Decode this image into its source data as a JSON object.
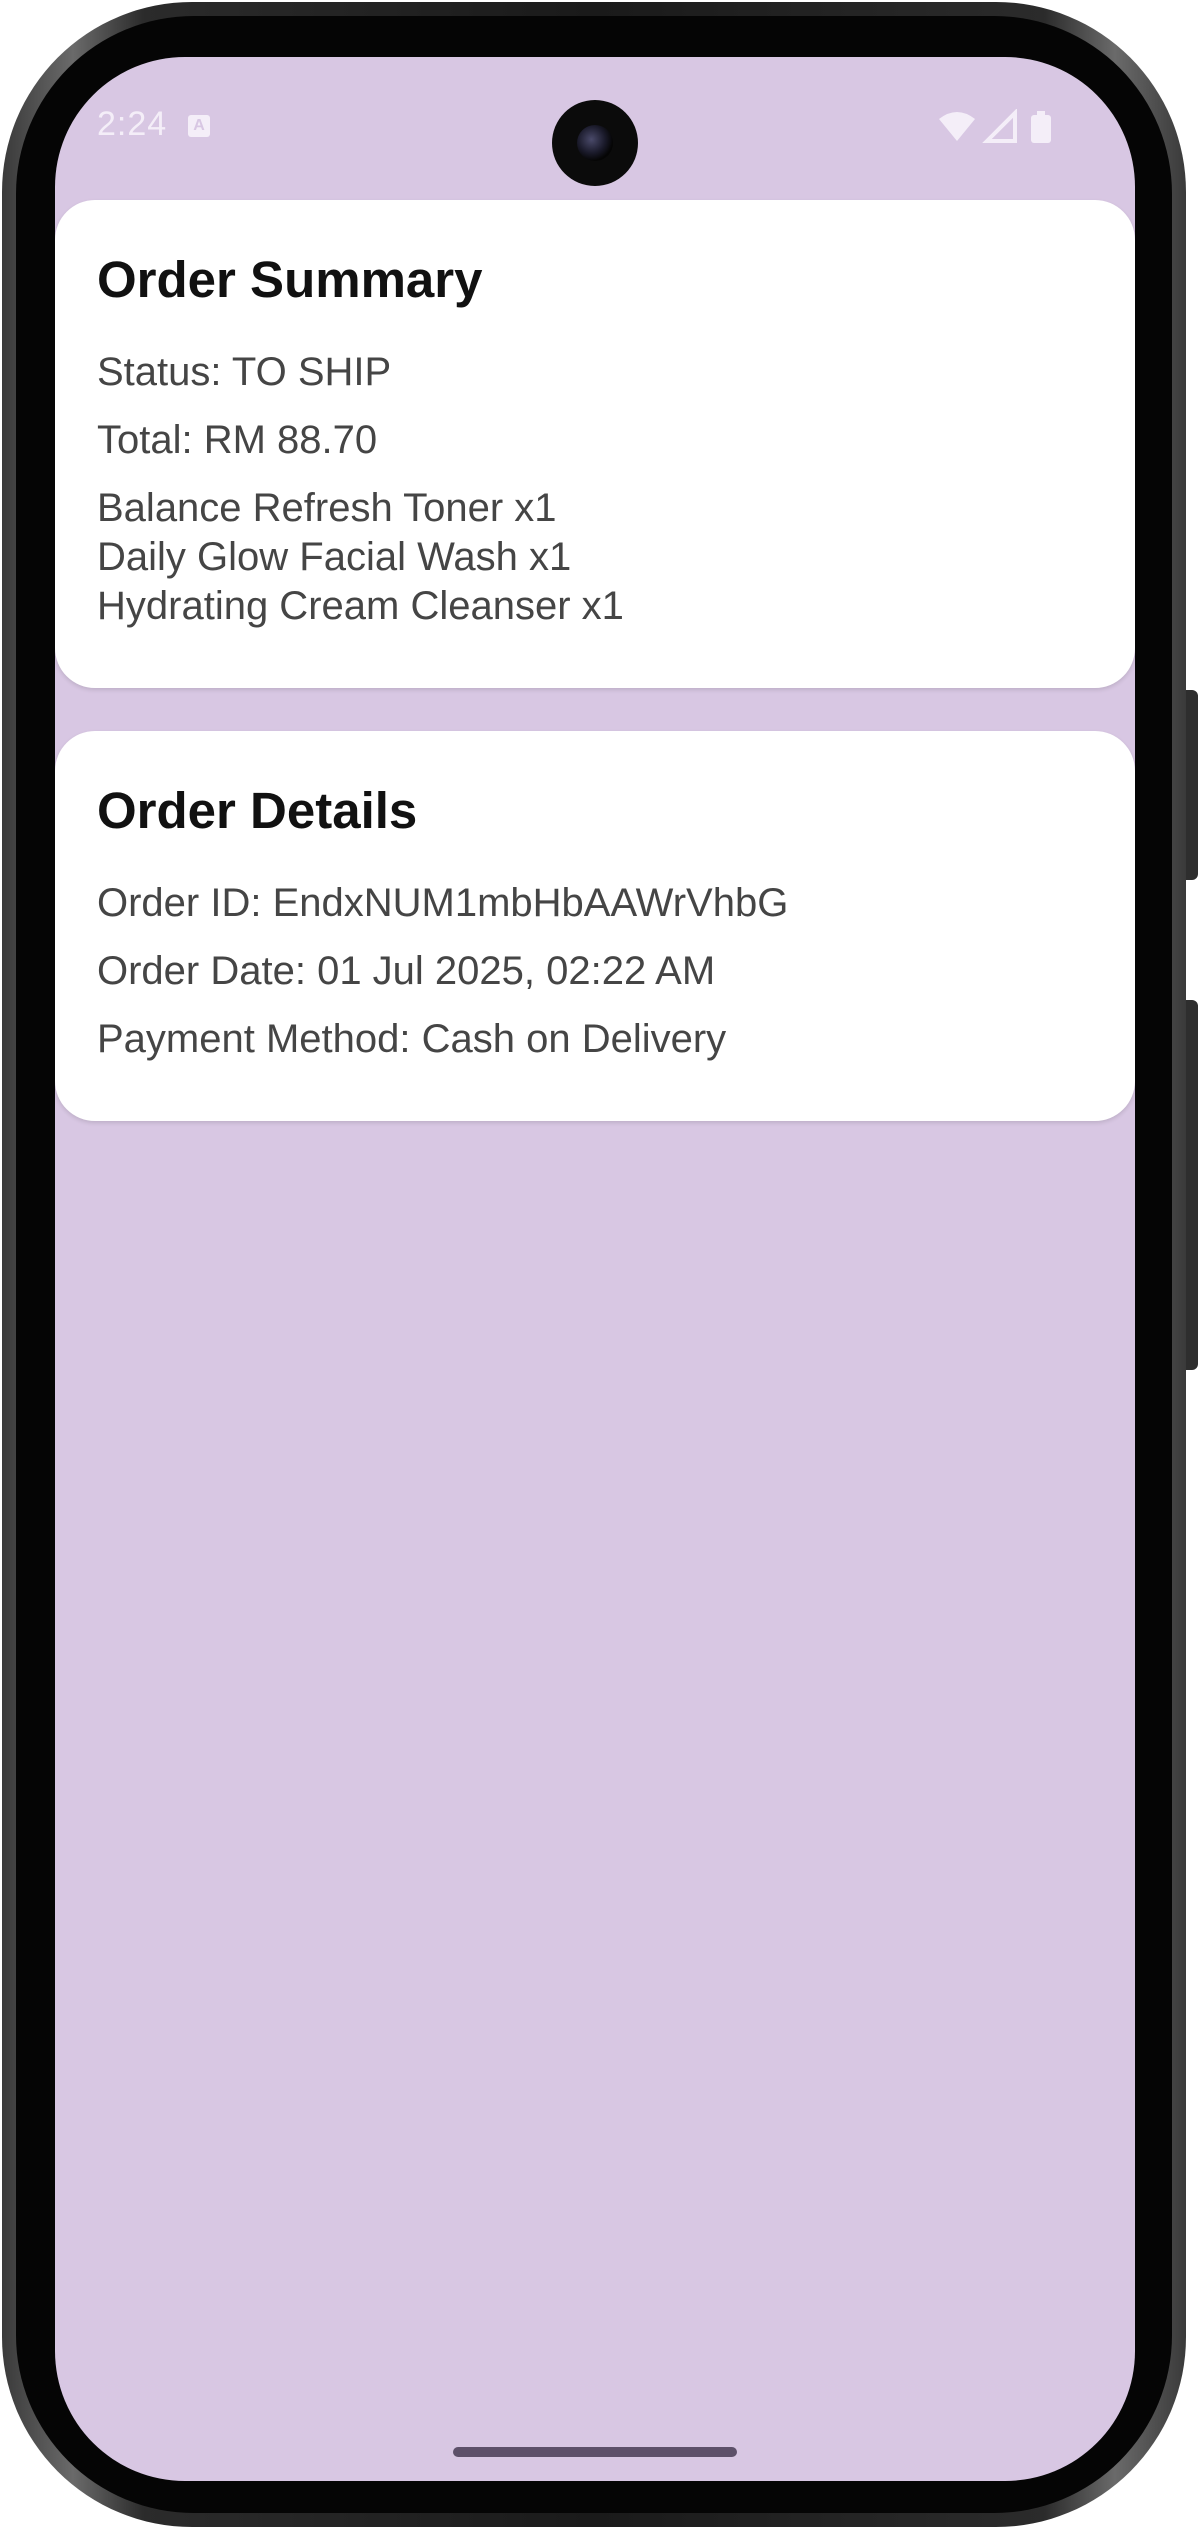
{
  "status_bar": {
    "time": "2:24",
    "notification_icon": "a-icon",
    "icons": [
      "wifi-icon",
      "signal-icon",
      "battery-icon"
    ]
  },
  "order_summary": {
    "title": "Order Summary",
    "status": "Status: TO SHIP",
    "total": "Total: RM 88.70",
    "items": [
      "Balance Refresh Toner x1",
      "Daily Glow Facial Wash x1",
      "Hydrating Cream Cleanser x1"
    ]
  },
  "order_details": {
    "title": "Order Details",
    "order_id": "Order ID: EndxNUM1mbHbAAWrVhbG",
    "order_date": "Order Date: 01 Jul 2025, 02:22 AM",
    "payment_method": "Payment Method: Cash on Delivery"
  },
  "colors": {
    "background": "#d8c7e3",
    "card": "#ffffff",
    "title_text": "#111111",
    "body_text": "#454545",
    "home_indicator": "#5d5069"
  }
}
